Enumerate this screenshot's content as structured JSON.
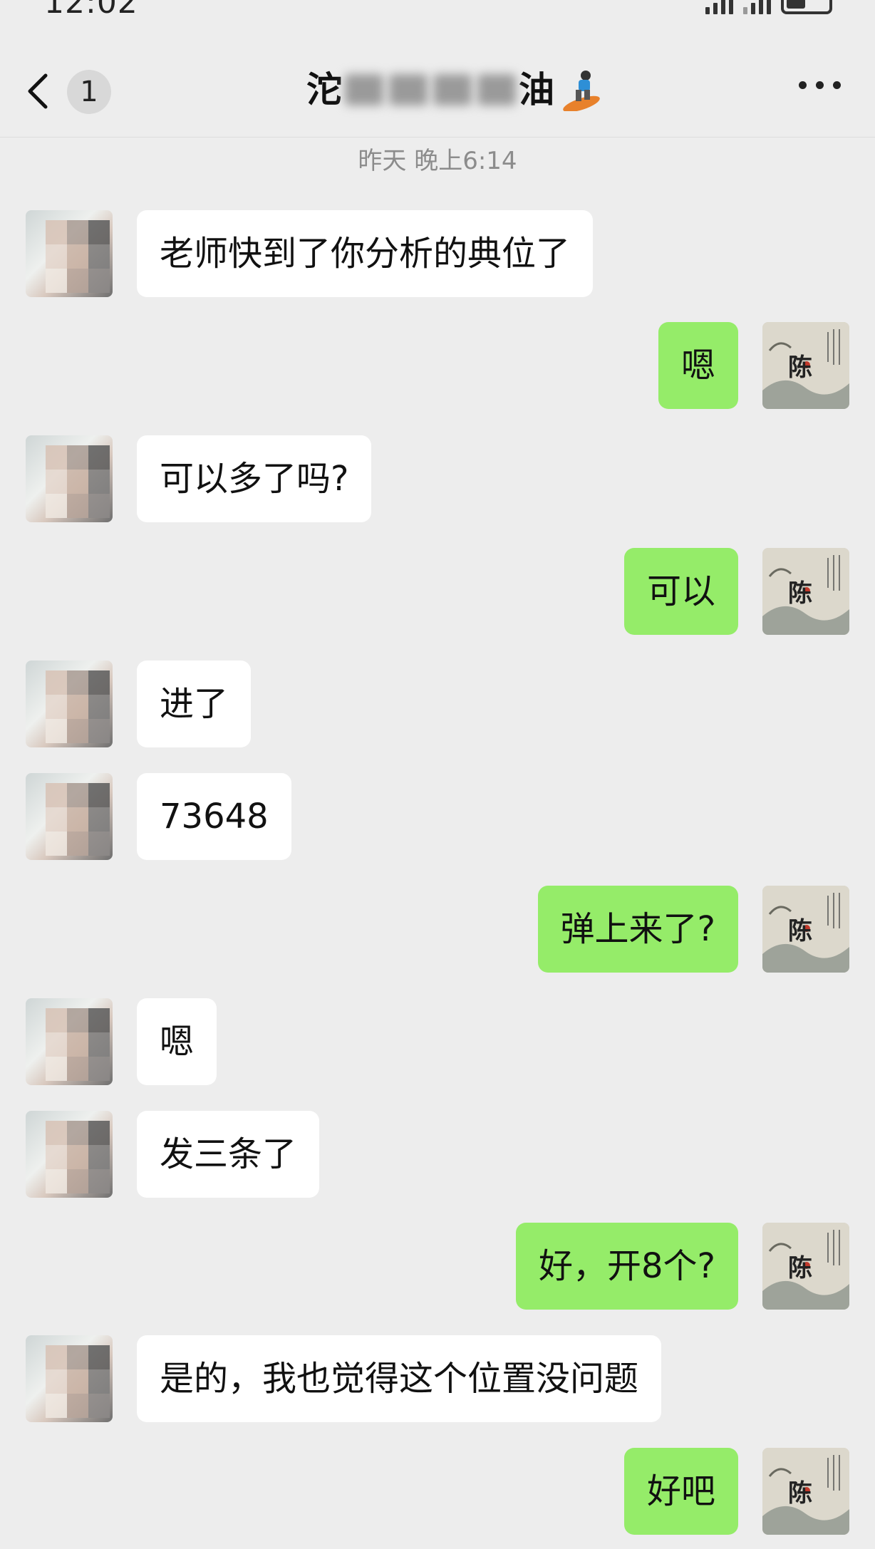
{
  "status_bar": {
    "time": "12:02"
  },
  "header": {
    "unread_count": "1",
    "title_start": "沱",
    "title_end": "油",
    "back_icon": "chevron-left-icon",
    "more_icon": "more-dots-icon",
    "title_emoji": "snowboarder-icon"
  },
  "timestamp": "昨天 晚上6:14",
  "messages": [
    {
      "side": "left",
      "text": "老师快到了你分析的典位了"
    },
    {
      "side": "right",
      "text": "嗯"
    },
    {
      "side": "left",
      "text": "可以多了吗?"
    },
    {
      "side": "right",
      "text": "可以"
    },
    {
      "side": "left",
      "text": "进了"
    },
    {
      "side": "left",
      "text": "73648"
    },
    {
      "side": "right",
      "text": "弹上来了?"
    },
    {
      "side": "left",
      "text": "嗯"
    },
    {
      "side": "left",
      "text": "发三条了"
    },
    {
      "side": "right",
      "text": "好，开8个?"
    },
    {
      "side": "left",
      "text": "是的，我也觉得这个位置没问题"
    },
    {
      "side": "right",
      "text": "好吧"
    }
  ],
  "avatar_right_glyph": "陈",
  "colors": {
    "background": "#ededed",
    "bubble_self": "#95ec69",
    "bubble_other": "#ffffff"
  }
}
